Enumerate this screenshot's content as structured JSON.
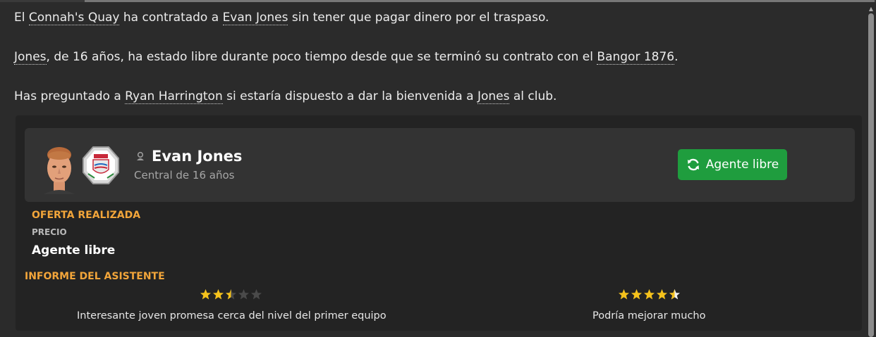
{
  "news": {
    "p1": {
      "t1": "El ",
      "club": "Connah's Quay",
      "t2": " ha contratado a ",
      "player": "Evan Jones",
      "t3": " sin tener que pagar dinero por el traspaso."
    },
    "p2": {
      "player": "Jones",
      "t1": ", de 16 años, ha estado libre durante poco tiempo desde que se terminó su contrato con el ",
      "club": "Bangor 1876",
      "t2": "."
    },
    "p3": {
      "t1": "Has preguntado a ",
      "person": "Ryan Harrington",
      "t2": " si estaría dispuesto a dar la bienvenida a ",
      "player": "Jones",
      "t3": " al club."
    }
  },
  "player": {
    "name": "Evan Jones",
    "subtitle": "Central de 16 años",
    "status_button": "Agente libre",
    "status_icon": "refresh-icon"
  },
  "offer": {
    "title": "OFERTA REALIZADA",
    "price_label": "PRECIO",
    "price_value": "Agente libre"
  },
  "report": {
    "title": "INFORME DEL ASISTENTE",
    "current": {
      "rating": 2.5,
      "max": 5,
      "text": "Interesante joven promesa cerca del nivel del primer equipo"
    },
    "potential": {
      "rating": 4.5,
      "max": 5,
      "text": "Podría mejorar mucho"
    }
  },
  "colors": {
    "accent_orange": "#f2a53a",
    "button_green": "#1f9d3e",
    "star_gold": "#f5c21b",
    "star_empty": "#4a4a4a"
  }
}
